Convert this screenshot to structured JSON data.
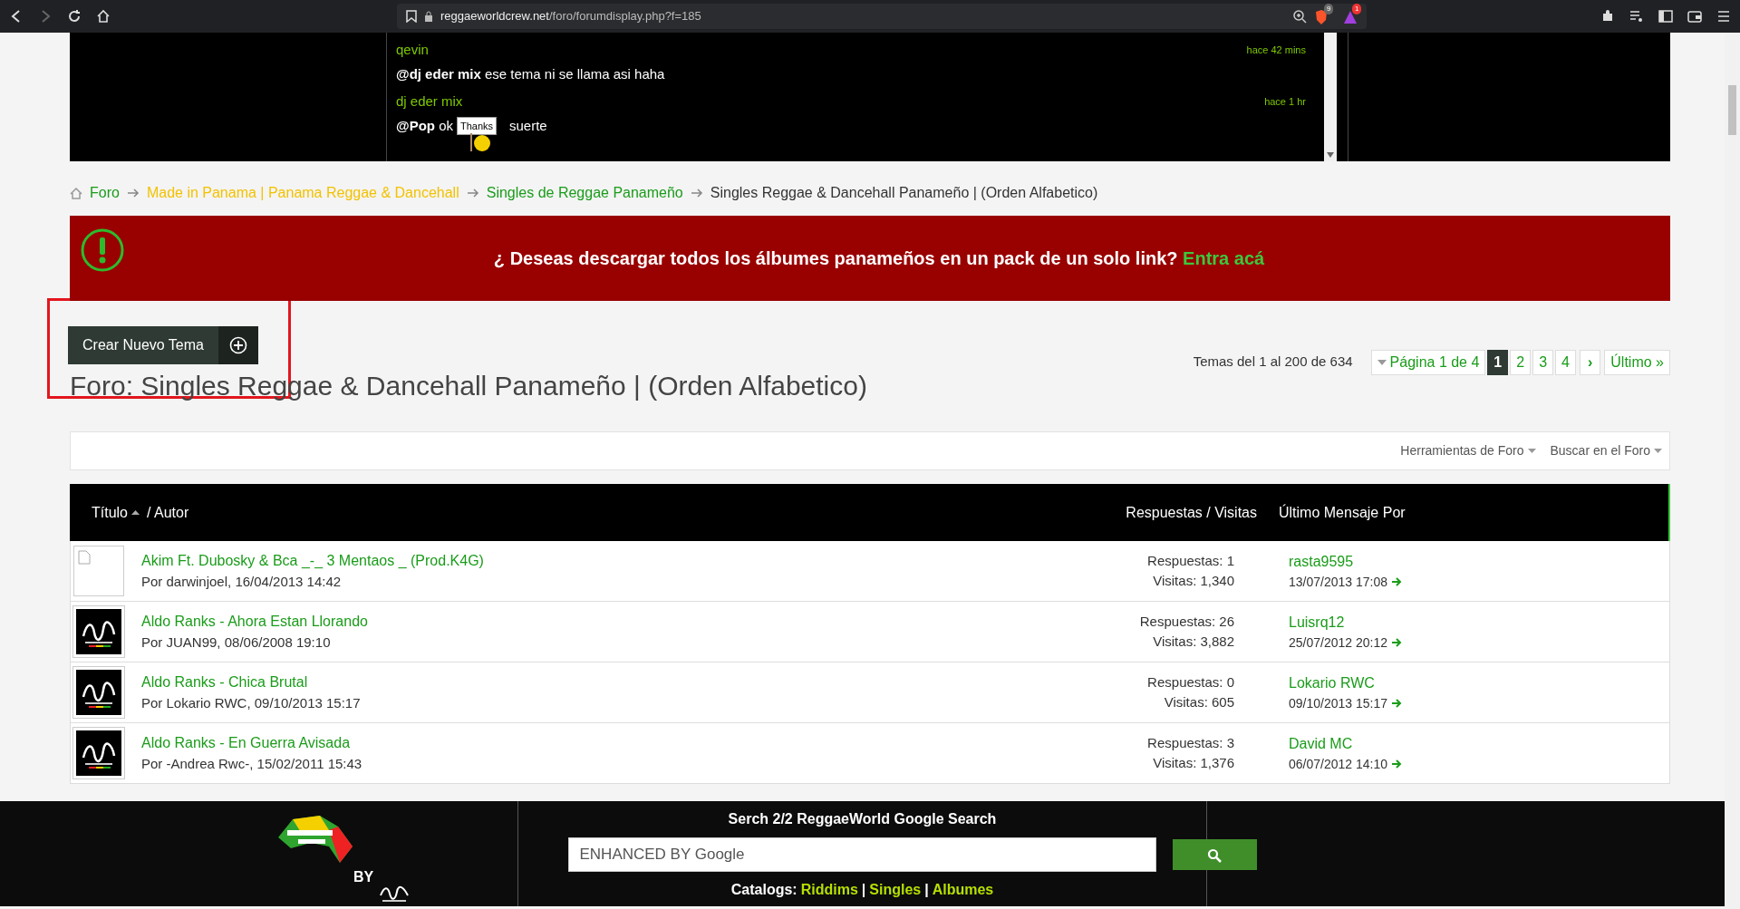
{
  "browser": {
    "url_domain": "reggaeworldcrew.net",
    "url_path": "/foro/forumdisplay.php?f=185",
    "shield_count": "9",
    "alert_count": "1"
  },
  "chat": {
    "messages": [
      {
        "user": "qevin",
        "time": "hace 42 mins",
        "mention": "@dj eder mix",
        "text": "ese tema ni se llama asi haha"
      },
      {
        "user": "dj eder mix",
        "time": "hace 1 hr",
        "mention": "@Pop",
        "text": "ok",
        "sticker": "Thanks",
        "after": "suerte"
      }
    ]
  },
  "breadcrumb": [
    {
      "label": "Foro",
      "color": "#1a9c1a"
    },
    {
      "label": "Made in Panama | Panama Reggae & Dancehall",
      "color": "#f2c200"
    },
    {
      "label": "Singles de Reggae Panameño",
      "color": "#1a9c1a"
    },
    {
      "label": "Singles Reggae & Dancehall Panameño | (Orden Alfabetico)",
      "color": "#333333"
    }
  ],
  "banner": {
    "text": "¿ Deseas descargar todos los álbumes panameños en un pack de un solo link?",
    "link": "Entra acá"
  },
  "new_topic_button": {
    "label": "Crear Nuevo Tema",
    "highlighted": true
  },
  "pagination": {
    "summary": "Temas del 1 al 200 de 634",
    "page_label": "Página 1 de 4",
    "pages": [
      {
        "label": "1",
        "selected": true
      },
      {
        "label": "2",
        "selected": false
      },
      {
        "label": "3",
        "selected": false
      },
      {
        "label": "4",
        "selected": false
      }
    ],
    "next": "›",
    "last": "Último »"
  },
  "forum_title": "Foro: Singles Reggae & Dancehall Panameño | (Orden Alfabetico)",
  "tools": [
    "Herramientas de Foro",
    "Buscar en el Foro"
  ],
  "table": {
    "columns": [
      "Título",
      "/ Autor",
      "Respuestas / Visitas",
      "Último Mensaje Por"
    ],
    "rows": [
      {
        "kind": "broken",
        "title": "Akim Ft. Dubosky & Bca _-_ 3 Mentaos _ (Prod.K4G)",
        "author": "Por darwinjoel, 16/04/2013 14:42",
        "replies": "Respuestas: 1",
        "views": "Visitas: 1,340",
        "last_user": "rasta9595",
        "last_date": "13/07/2013 17:08"
      },
      {
        "kind": "logo",
        "title": "Aldo Ranks - Ahora Estan Llorando",
        "author": "Por JUAN99, 08/06/2008 19:10",
        "replies": "Respuestas: 26",
        "views": "Visitas: 3,882",
        "last_user": "Luisrq12",
        "last_date": "25/07/2012 20:12"
      },
      {
        "kind": "logo",
        "title": "Aldo Ranks - Chica Brutal",
        "author": "Por Lokario RWC, 09/10/2013 15:17",
        "replies": "Respuestas: 0",
        "views": "Visitas: 605",
        "last_user": "Lokario RWC",
        "last_date": "09/10/2013 15:17"
      },
      {
        "kind": "logo",
        "title": "Aldo Ranks - En Guerra Avisada",
        "author": "Por -Andrea Rwc-, 15/02/2011 15:43",
        "replies": "Respuestas: 3",
        "views": "Visitas: 1,376",
        "last_user": "David MC",
        "last_date": "06/07/2012 14:10"
      }
    ]
  },
  "footer": {
    "by": "BY",
    "search_title": "Serch 2/2 ReggaeWorld Google Search",
    "search_placeholder": "ENHANCED BY Google",
    "catalogs_label": "Catalogs:",
    "catalogs": [
      "Riddims",
      "Singles",
      "Albumes"
    ],
    "separator": "|"
  }
}
